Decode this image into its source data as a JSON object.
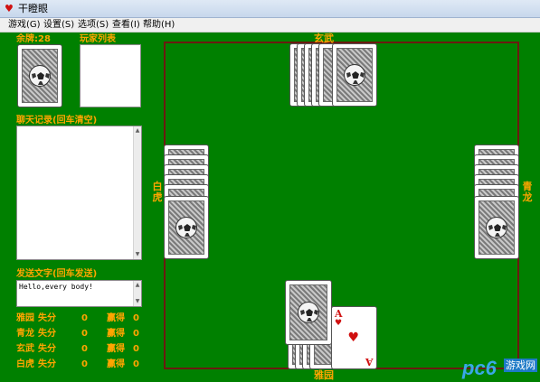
{
  "window": {
    "title": "干瞪眼"
  },
  "menu": [
    "游戏(G)",
    "设置(S)",
    "选项(S)",
    "查看(I)",
    "帮助(H)"
  ],
  "left_panel": {
    "remaining_label": "余牌:",
    "remaining_value": "28",
    "player_list_label": "玩家列表",
    "chat_label": "聊天记录(回车清空)",
    "send_label": "发送文字(回车发送)",
    "send_value": "Hello,every body!",
    "scores": [
      {
        "name": "雅园",
        "lose_label": "失分",
        "lose": "0",
        "win_label": "赢得",
        "win": "0"
      },
      {
        "name": "青龙",
        "lose_label": "失分",
        "lose": "0",
        "win_label": "赢得",
        "win": "0"
      },
      {
        "name": "玄武",
        "lose_label": "失分",
        "lose": "0",
        "win_label": "赢得",
        "win": "0"
      },
      {
        "name": "白虎",
        "lose_label": "失分",
        "lose": "0",
        "win_label": "赢得",
        "win": "0"
      }
    ]
  },
  "seats": {
    "top": "玄武",
    "left": "白虎",
    "right": "青龙",
    "bottom": "雅园"
  },
  "played_card": {
    "rank": "A",
    "suit": "♥"
  },
  "watermark": {
    "brand": "pc6",
    "sub": "游戏网"
  },
  "colors": {
    "felt": "#008000",
    "border": "#6b1a10",
    "label": "#ffa500",
    "heart": "#d01010"
  },
  "icons": {
    "app": "heart-icon",
    "card_back": "soccer-ball-card-back"
  }
}
